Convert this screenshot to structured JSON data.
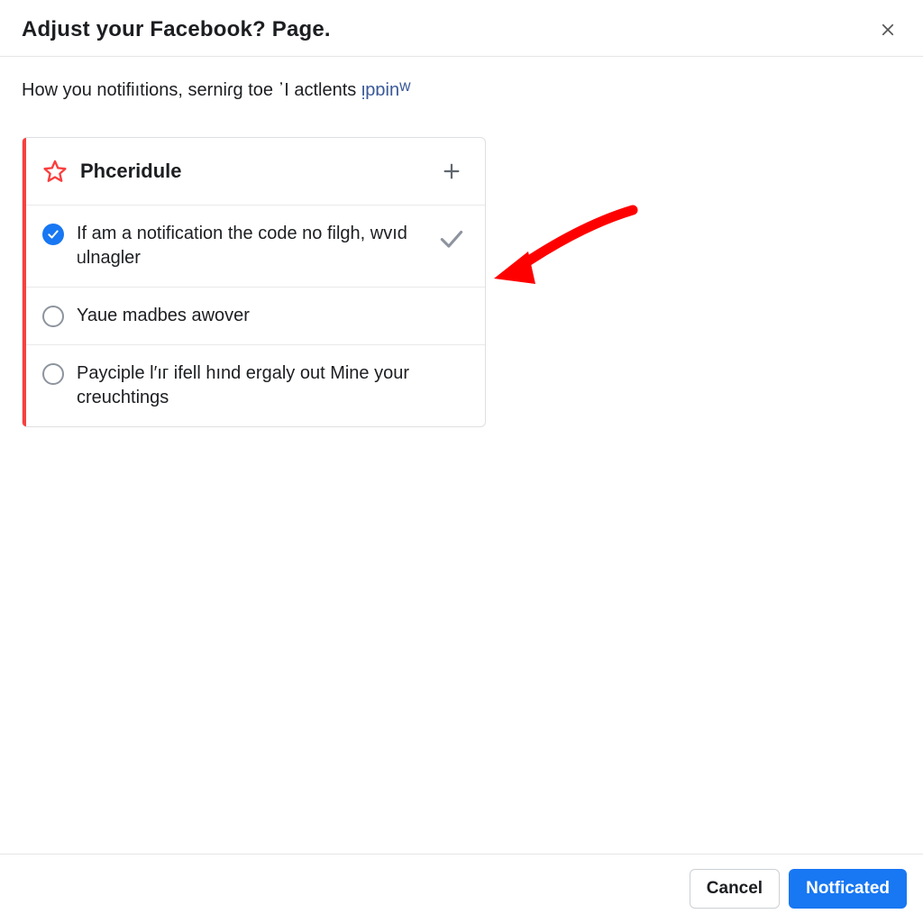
{
  "header": {
    "title": "Adjust your Facebook? Page."
  },
  "subtext": {
    "prefix": "How you notifiıtions, serniɾg toe ᾽I actӏents ",
    "link": "ᴉрɒіnᵂ"
  },
  "card": {
    "title": "Phceridule",
    "options": [
      {
        "label": "If am a notification the code no filgh, wᴠıd ᥙlnagler",
        "selected": true,
        "trailing_check": true
      },
      {
        "label": "Yaue madbes aᴡover",
        "selected": false,
        "trailing_check": false
      },
      {
        "label": "Payciple l′ıг ifell hınd ergaly out Mine your creuchtings",
        "selected": false,
        "trailing_check": false
      }
    ]
  },
  "footer": {
    "cancel": "Cancel",
    "primary": "Notficated"
  },
  "colors": {
    "accent_red": "#fa3e3e",
    "primary_blue": "#1877f2",
    "link_blue": "#385898"
  }
}
